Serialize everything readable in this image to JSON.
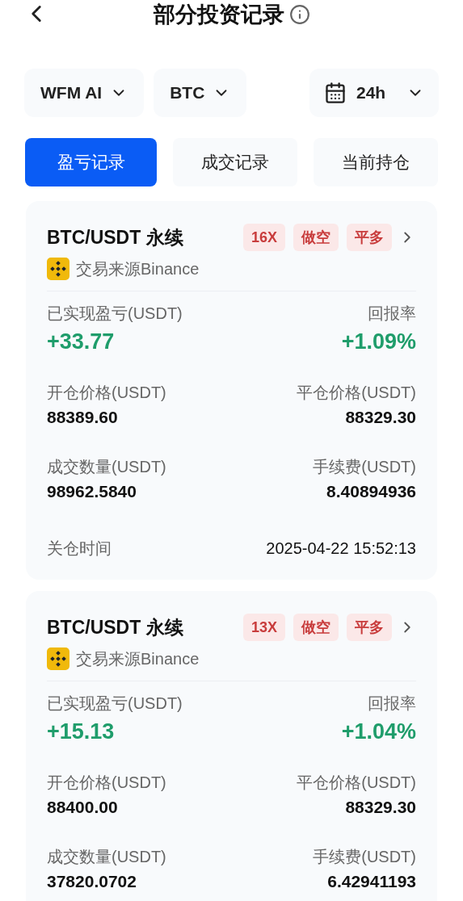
{
  "header": {
    "title": "部分投资记录"
  },
  "filters": [
    {
      "label": "WFM AI",
      "kind": "plain"
    },
    {
      "label": "BTC",
      "kind": "plain"
    },
    {
      "label": "24h",
      "kind": "date"
    }
  ],
  "tabs": [
    {
      "label": "盈亏记录",
      "selected": true
    },
    {
      "label": "成交记录",
      "selected": false
    },
    {
      "label": "当前持仓",
      "selected": false
    }
  ],
  "records": [
    {
      "pair": "BTC/USDT 永续",
      "tags": [
        "16X",
        "做空",
        "平多"
      ],
      "source": "交易来源Binance",
      "pnl_label": "已实现盈亏(USDT)",
      "pnl": "+33.77",
      "roi_label": "回报率",
      "roi": "+1.09%",
      "fields": [
        {
          "label": "开仓价格(USDT)",
          "value": "88389.60"
        },
        {
          "label": "平仓价格(USDT)",
          "value": "88329.30"
        },
        {
          "label": "成交数量(USDT)",
          "value": "98962.5840"
        },
        {
          "label": "手续费(USDT)",
          "value": "8.40894936"
        }
      ],
      "close_label": "关仓时间",
      "close_time": "2025-04-22 15:52:13"
    },
    {
      "pair": "BTC/USDT 永续",
      "tags": [
        "13X",
        "做空",
        "平多"
      ],
      "source": "交易来源Binance",
      "pnl_label": "已实现盈亏(USDT)",
      "pnl": "+15.13",
      "roi_label": "回报率",
      "roi": "+1.04%",
      "fields": [
        {
          "label": "开仓价格(USDT)",
          "value": "88400.00"
        },
        {
          "label": "平仓价格(USDT)",
          "value": "88329.30"
        },
        {
          "label": "成交数量(USDT)",
          "value": "37820.0702"
        },
        {
          "label": "手续费(USDT)",
          "value": "6.42941193"
        }
      ]
    }
  ]
}
